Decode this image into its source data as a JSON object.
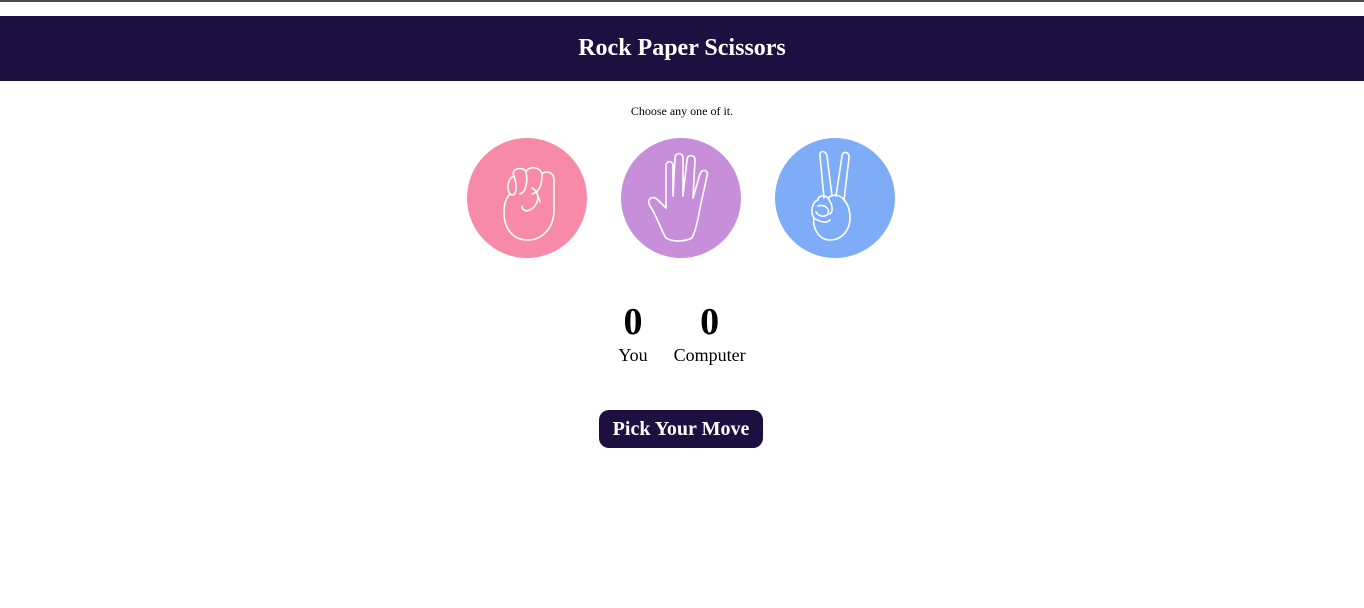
{
  "header": {
    "title": "Rock Paper Scissors"
  },
  "prompt": "Choose any one of it.",
  "choices": [
    {
      "name": "rock",
      "icon": "rock-fist-icon",
      "color": "#f78aa6"
    },
    {
      "name": "paper",
      "icon": "paper-hand-icon",
      "color": "#c78fda"
    },
    {
      "name": "scissors",
      "icon": "scissors-hand-icon",
      "color": "#7eacf7"
    }
  ],
  "score": {
    "user": {
      "value": "0",
      "label": "You"
    },
    "computer": {
      "value": "0",
      "label": "Computer"
    }
  },
  "action": {
    "label": "Pick Your Move"
  },
  "colors": {
    "brand": "#1d0f40"
  }
}
